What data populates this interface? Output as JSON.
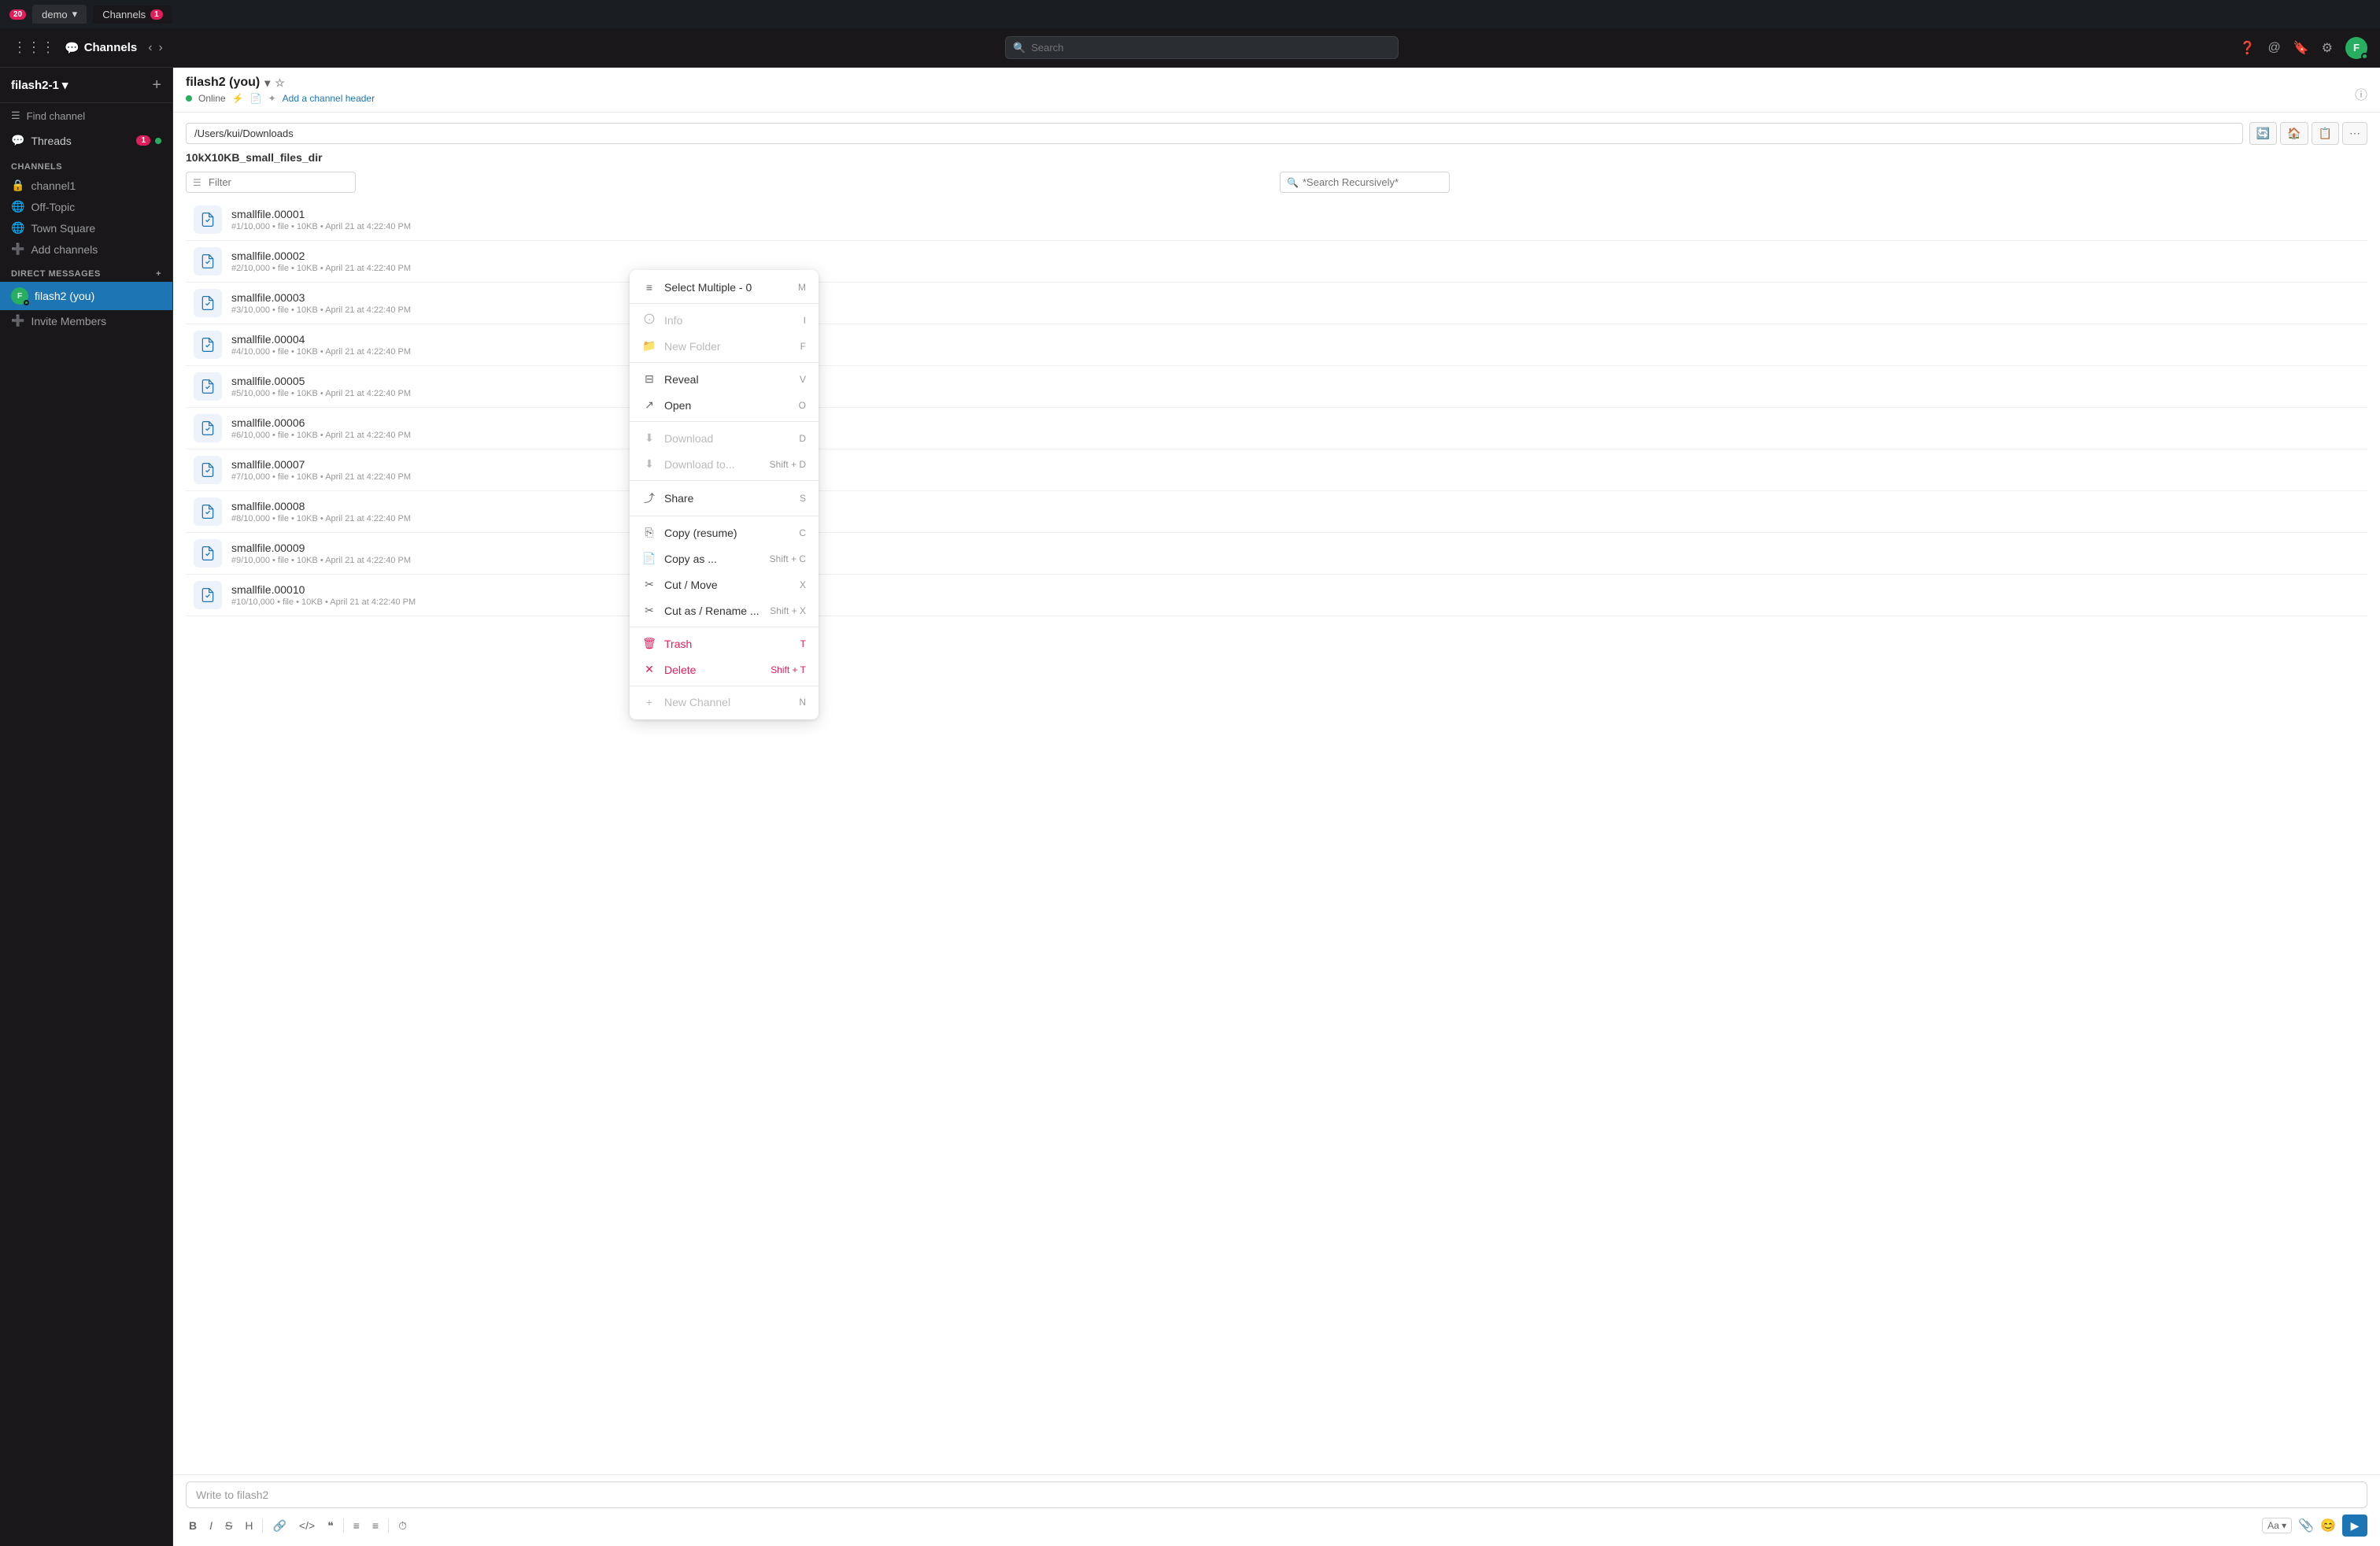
{
  "os_bar": {
    "badge": "20",
    "tabs": [
      {
        "label": "demo",
        "dropdown": true
      },
      {
        "label": "Channels",
        "badge": "1",
        "active": true
      }
    ]
  },
  "app_header": {
    "app_name": "Channels",
    "search_placeholder": "Search",
    "actions": [
      "at-icon",
      "bookmark-icon",
      "gear-icon"
    ]
  },
  "sidebar": {
    "workspace": "filash2-1",
    "find_channel_placeholder": "Find channel",
    "threads_label": "Threads",
    "threads_badge": "1",
    "channels_section": "CHANNELS",
    "channels": [
      {
        "name": "channel1",
        "icon": "lock"
      },
      {
        "name": "Off-Topic",
        "icon": "globe"
      },
      {
        "name": "Town Square",
        "icon": "globe"
      }
    ],
    "add_channels": "Add channels",
    "direct_messages": "DIRECT MESSAGES",
    "dm_items": [
      {
        "name": "filash2 (you)",
        "active": true
      },
      {
        "name": "Invite Members"
      }
    ]
  },
  "channel": {
    "title": "filash2 (you)",
    "status": "Online",
    "add_header": "Add a channel header",
    "path": "/Users/kui/Downloads",
    "dir_name": "10kX10KB_small_files_dir",
    "filter_placeholder": "Filter",
    "search_placeholder": "*Search Recursively*",
    "files": [
      {
        "name": "smallfile.00001",
        "meta": "#1/10,000  •  file  •  10KB  •  April 21 at 4:22:40 PM"
      },
      {
        "name": "smallfile.00002",
        "meta": "#2/10,000  •  file  •  10KB  •  April 21 at 4:22:40 PM"
      },
      {
        "name": "smallfile.00003",
        "meta": "#3/10,000  •  file  •  10KB  •  April 21 at 4:22:40 PM"
      },
      {
        "name": "smallfile.00004",
        "meta": "#4/10,000  •  file  •  10KB  •  April 21 at 4:22:40 PM"
      },
      {
        "name": "smallfile.00005",
        "meta": "#5/10,000  •  file  •  10KB  •  April 21 at 4:22:40 PM"
      },
      {
        "name": "smallfile.00006",
        "meta": "#6/10,000  •  file  •  10KB  •  April 21 at 4:22:40 PM"
      },
      {
        "name": "smallfile.00007",
        "meta": "#7/10,000  •  file  •  10KB  •  April 21 at 4:22:40 PM"
      },
      {
        "name": "smallfile.00008",
        "meta": "#8/10,000  •  file  •  10KB  •  April 21 at 4:22:40 PM"
      },
      {
        "name": "smallfile.00009",
        "meta": "#9/10,000  •  file  •  10KB  •  April 21 at 4:22:40 PM"
      },
      {
        "name": "smallfile.00010",
        "meta": "#10/10,000  •  file  •  10KB  •  April 21 at 4:22:40 PM"
      }
    ],
    "message_placeholder": "Write to filash2",
    "toolbar": {
      "bold": "B",
      "italic": "I",
      "strike": "S",
      "heading": "H",
      "link": "🔗",
      "code": "</>",
      "quote": "\"",
      "ul": "≡",
      "ol": "≡",
      "timer": "⏱"
    }
  },
  "context_menu": {
    "items": [
      {
        "label": "Select Multiple - 0",
        "icon": "☰",
        "shortcut": "M",
        "type": "normal"
      },
      {
        "type": "divider"
      },
      {
        "label": "Info",
        "icon": "ℹ",
        "shortcut": "I",
        "type": "disabled"
      },
      {
        "label": "New Folder",
        "icon": "📁",
        "shortcut": "F",
        "type": "disabled"
      },
      {
        "type": "divider"
      },
      {
        "label": "Reveal",
        "icon": "⊞",
        "shortcut": "V",
        "type": "normal"
      },
      {
        "label": "Open",
        "icon": "↗",
        "shortcut": "O",
        "type": "normal"
      },
      {
        "type": "divider"
      },
      {
        "label": "Download",
        "icon": "⬇",
        "shortcut": "D",
        "type": "disabled"
      },
      {
        "label": "Download to...",
        "icon": "⬇",
        "shortcut": "Shift + D",
        "type": "disabled"
      },
      {
        "type": "divider"
      },
      {
        "label": "Share",
        "icon": "⤴",
        "shortcut": "S",
        "type": "normal"
      },
      {
        "type": "divider"
      },
      {
        "label": "Copy (resume)",
        "icon": "⎘",
        "shortcut": "C",
        "type": "normal"
      },
      {
        "label": "Copy as ...",
        "icon": "📄",
        "shortcut": "Shift + C",
        "type": "normal"
      },
      {
        "label": "Cut / Move",
        "icon": "✂",
        "shortcut": "X",
        "type": "normal"
      },
      {
        "label": "Cut as / Rename ...",
        "icon": "✂",
        "shortcut": "Shift + X",
        "type": "normal"
      },
      {
        "type": "divider"
      },
      {
        "label": "Trash",
        "icon": "🗑",
        "shortcut": "T",
        "type": "danger"
      },
      {
        "label": "Delete",
        "icon": "✕",
        "shortcut": "Shift + T",
        "type": "danger"
      },
      {
        "type": "divider"
      },
      {
        "label": "New Channel",
        "icon": "+",
        "shortcut": "N",
        "type": "disabled"
      }
    ]
  }
}
